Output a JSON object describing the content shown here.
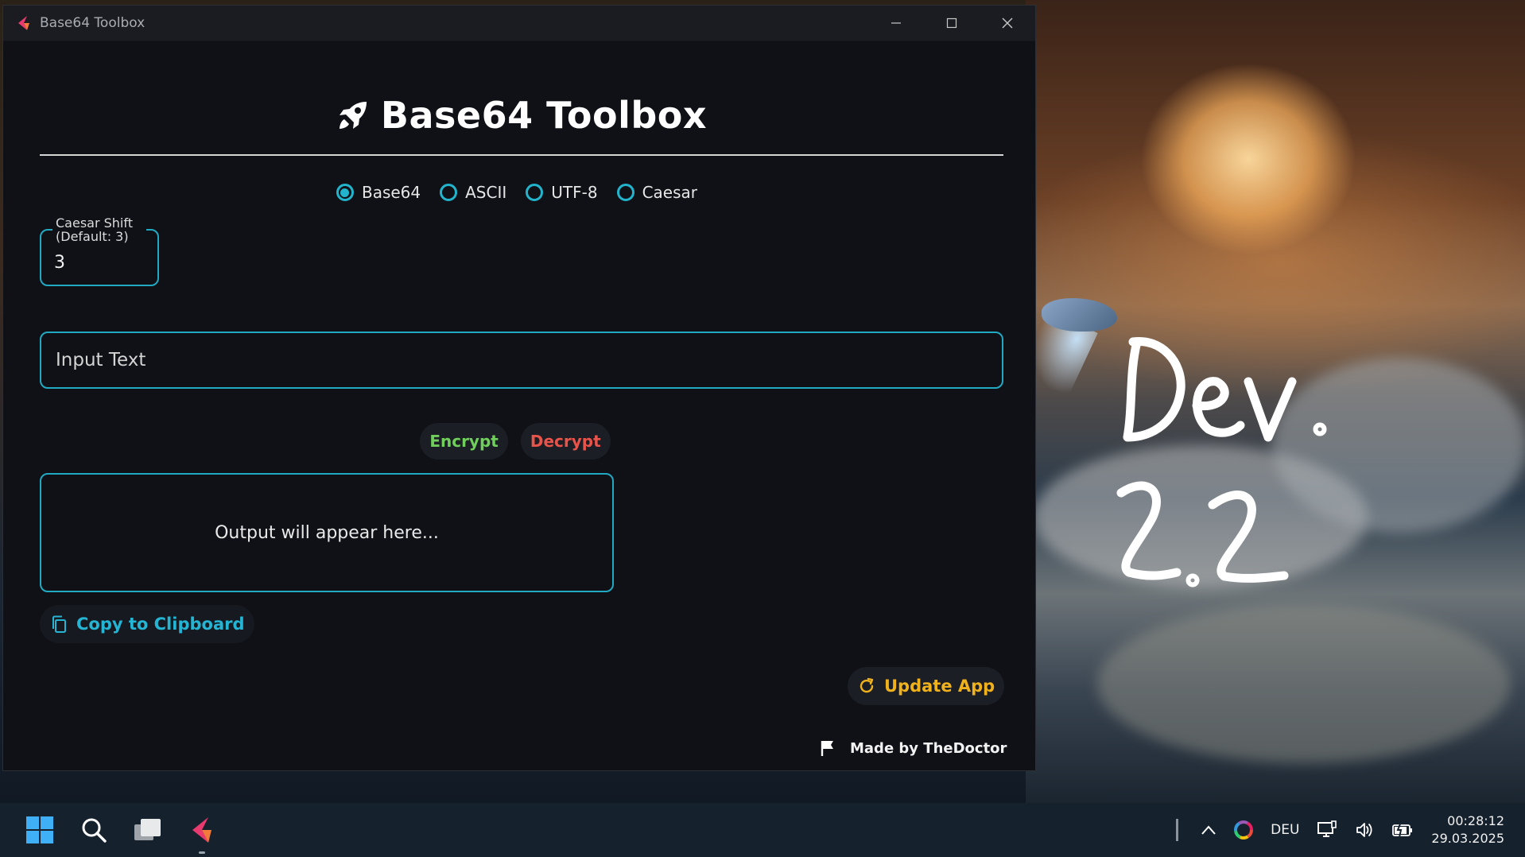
{
  "window": {
    "title": "Base64 Toolbox",
    "controls": {
      "minimize": "minimize-icon",
      "maximize": "maximize-icon",
      "close": "close-icon"
    }
  },
  "header": {
    "title": "Base64 Toolbox",
    "icon": "rocket-icon"
  },
  "modes": {
    "selected": "Base64",
    "options": [
      "Base64",
      "ASCII",
      "UTF-8",
      "Caesar"
    ]
  },
  "caesar_shift": {
    "label": "Caesar Shift\n(Default: 3)",
    "label_line1": "Caesar Shift",
    "label_line2": "(Default: 3)",
    "value": "3"
  },
  "input": {
    "placeholder": "Input Text",
    "value": ""
  },
  "actions": {
    "encrypt_label": "Encrypt",
    "decrypt_label": "Decrypt"
  },
  "output": {
    "placeholder": "Output will appear here..."
  },
  "copy": {
    "label": "Copy to Clipboard",
    "icon": "copy-icon"
  },
  "update": {
    "label": "Update App",
    "icon": "refresh-icon"
  },
  "footer": {
    "text": "Made by TheDoctor",
    "icon": "flag-icon"
  },
  "desktop": {
    "note_line1": "Dev.",
    "note_line2": "2.2"
  },
  "taskbar": {
    "language": "DEU",
    "time": "00:28:12",
    "date": "29.03.2025"
  },
  "colors": {
    "accent": "#22b4cc",
    "encrypt": "#6fcf5a",
    "decrypt": "#e8534a",
    "update": "#f0b21c",
    "window_bg": "#0f1116"
  }
}
